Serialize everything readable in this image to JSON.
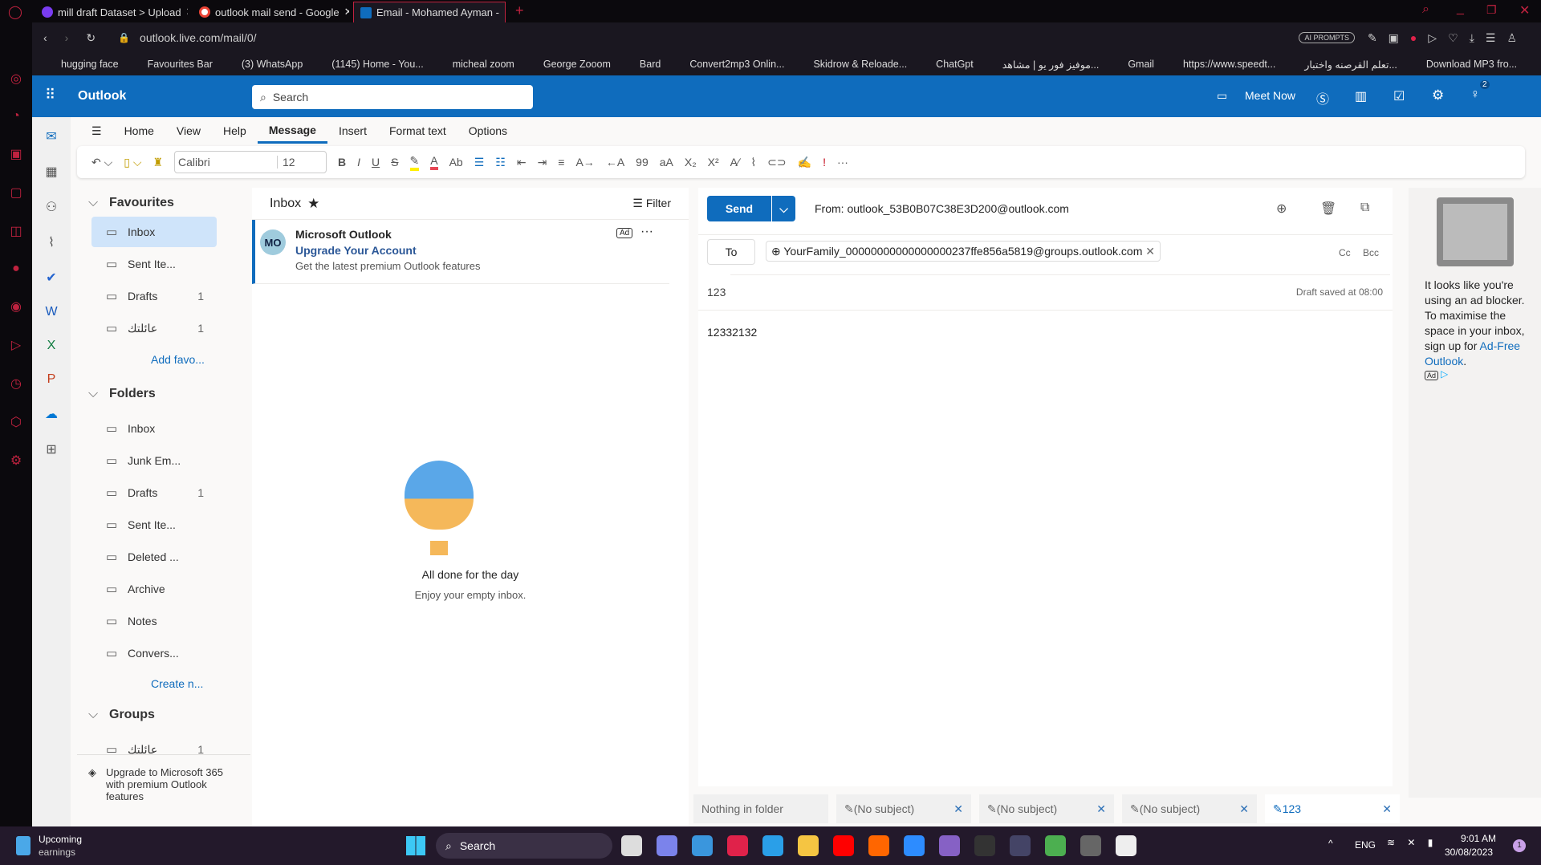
{
  "browser": {
    "tabs": [
      {
        "title": "mill draft Dataset > Upload",
        "color": "#7a3cf0"
      },
      {
        "title": "outlook mail send - Google",
        "color": "#fbbc05"
      },
      {
        "title": "Email - Mohamed Ayman -",
        "color": "#0f6cbd",
        "active": true
      }
    ],
    "url": "outlook.live.com/mail/0/",
    "ai_prompts": "AI PROMPTS",
    "bookmarks": [
      "hugging face",
      "Favourites Bar",
      "(3) WhatsApp",
      "(1145) Home - You...",
      "micheal zoom",
      "George Zooom",
      "Bard",
      "Convert2mp3 Onlin...",
      "Skidrow & Reloade...",
      "ChatGpt",
      "موفيز فور يو | مشاهد...",
      "Gmail",
      "https://www.speedt...",
      "تعلم القرصنه واختبار...",
      "Download MP3 fro..."
    ]
  },
  "outlook": {
    "app_name": "Outlook",
    "search_placeholder": "Search",
    "meet_now": "Meet Now",
    "notif_count": "2",
    "ribbon_tabs": [
      "Home",
      "View",
      "Help",
      "Message",
      "Insert",
      "Format text",
      "Options"
    ],
    "active_tab": "Message",
    "font": "Calibri",
    "font_size": "12",
    "folders": {
      "favourites_label": "Favourites",
      "favourites": [
        {
          "label": "Inbox",
          "icon": "inbox-icon",
          "count": ""
        },
        {
          "label": "Sent Ite...",
          "icon": "send-icon",
          "count": ""
        },
        {
          "label": "Drafts",
          "icon": "drafts-icon",
          "count": "1"
        },
        {
          "label": "عائلتك",
          "icon": "group-icon",
          "count": "1"
        }
      ],
      "add_favourite": "Add favo...",
      "folders_label": "Folders",
      "folders": [
        {
          "label": "Inbox",
          "icon": "inbox-icon",
          "count": ""
        },
        {
          "label": "Junk Em...",
          "icon": "junk-icon",
          "count": ""
        },
        {
          "label": "Drafts",
          "icon": "drafts-icon",
          "count": "1"
        },
        {
          "label": "Sent Ite...",
          "icon": "send-icon",
          "count": ""
        },
        {
          "label": "Deleted ...",
          "icon": "trash-icon",
          "count": ""
        },
        {
          "label": "Archive",
          "icon": "archive-icon",
          "count": ""
        },
        {
          "label": "Notes",
          "icon": "notes-icon",
          "count": ""
        },
        {
          "label": "Convers...",
          "icon": "folder-icon",
          "count": ""
        }
      ],
      "create_new": "Create n...",
      "groups_label": "Groups",
      "groups": [
        {
          "label": "عائلتك",
          "count": "1"
        }
      ],
      "upgrade": "Upgrade to Microsoft 365 with premium Outlook features"
    },
    "list": {
      "title": "Inbox",
      "filter": "Filter",
      "ad_item": {
        "initials": "MO",
        "sender": "Microsoft Outlook",
        "subject": "Upgrade Your Account",
        "preview": "Get the latest premium Outlook features",
        "badge": "Ad"
      },
      "empty_title": "All done for the day",
      "empty_sub": "Enjoy your empty inbox."
    },
    "compose": {
      "send": "Send",
      "from": "From: outlook_53B0B07C38E3D200@outlook.com",
      "to_label": "To",
      "recipient": "YourFamily_00000000000000000237ffe856a5819@groups.outlook.com",
      "cc": "Cc",
      "bcc": "Bcc",
      "subject": "123",
      "draft_saved": "Draft saved at 08:00",
      "body": "12332132"
    },
    "ad_panel": {
      "text": "It looks like you're using an ad blocker. To maximise the space in your inbox, sign up for",
      "link": "Ad-Free Outlook",
      "end": ".",
      "badge": "Ad"
    },
    "draft_tabs": [
      {
        "label": "Nothing in folder"
      },
      {
        "label": "(No subject)"
      },
      {
        "label": "(No subject)"
      },
      {
        "label": "(No subject)"
      },
      {
        "label": "123",
        "active": true
      }
    ]
  },
  "taskbar": {
    "widget_line1": "Upcoming",
    "widget_line2": "earnings",
    "search": "Search",
    "lang": "ENG",
    "time": "9:01 AM",
    "date": "30/08/2023",
    "notif": "1"
  }
}
